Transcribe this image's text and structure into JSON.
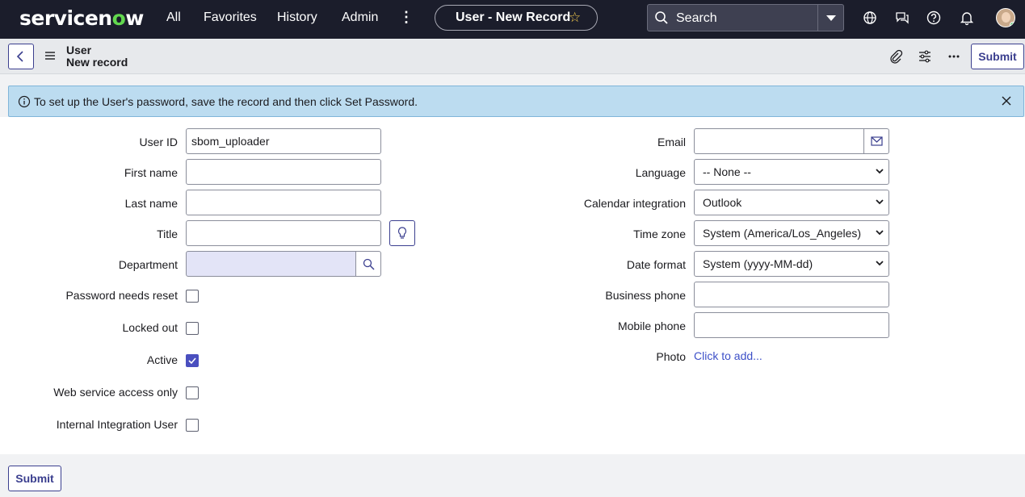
{
  "topnav": {
    "logo_prefix": "servicen",
    "logo_o": "o",
    "logo_suffix": "w",
    "items": [
      "All",
      "Favorites",
      "History",
      "Admin"
    ],
    "more_label": "⋮",
    "record_pill": "User - New Record",
    "star_glyph": "☆",
    "search_placeholder": "Search",
    "icons": [
      "globe-icon",
      "chat-icon",
      "help-icon",
      "bell-icon",
      "avatar"
    ]
  },
  "record_header": {
    "table_name": "User",
    "record_state": "New record",
    "submit_label": "Submit",
    "icons": [
      "paperclip-icon",
      "sliders-icon",
      "more-icon"
    ]
  },
  "banner": {
    "message": "To set up the User's password, save the record and then click Set Password."
  },
  "form": {
    "left": {
      "user_id": {
        "label": "User ID",
        "value": "sbom_uploader"
      },
      "first_name": {
        "label": "First name",
        "value": ""
      },
      "last_name": {
        "label": "Last name",
        "value": ""
      },
      "title": {
        "label": "Title",
        "value": ""
      },
      "department": {
        "label": "Department",
        "value": ""
      },
      "password_needs_reset": {
        "label": "Password needs reset",
        "checked": false
      },
      "locked_out": {
        "label": "Locked out",
        "checked": false
      },
      "active": {
        "label": "Active",
        "checked": true
      },
      "web_service_access_only": {
        "label": "Web service access only",
        "checked": false
      },
      "internal_integration_user": {
        "label": "Internal Integration User",
        "checked": false
      }
    },
    "right": {
      "email": {
        "label": "Email",
        "value": ""
      },
      "language": {
        "label": "Language",
        "value": "-- None --"
      },
      "calendar_integration": {
        "label": "Calendar integration",
        "value": "Outlook"
      },
      "time_zone": {
        "label": "Time zone",
        "value": "System (America/Los_Angeles)"
      },
      "date_format": {
        "label": "Date format",
        "value": "System (yyyy-MM-dd)"
      },
      "business_phone": {
        "label": "Business phone",
        "value": ""
      },
      "mobile_phone": {
        "label": "Mobile phone",
        "value": ""
      },
      "photo": {
        "label": "Photo",
        "link": "Click to add..."
      }
    }
  },
  "footer": {
    "submit_label": "Submit"
  },
  "colors": {
    "nav_bg": "#1b1d2b",
    "accent": "#3b3f8f",
    "banner_bg": "#bcdcf0",
    "link": "#3d50c8",
    "checkbox_on": "#4a4fbf"
  }
}
